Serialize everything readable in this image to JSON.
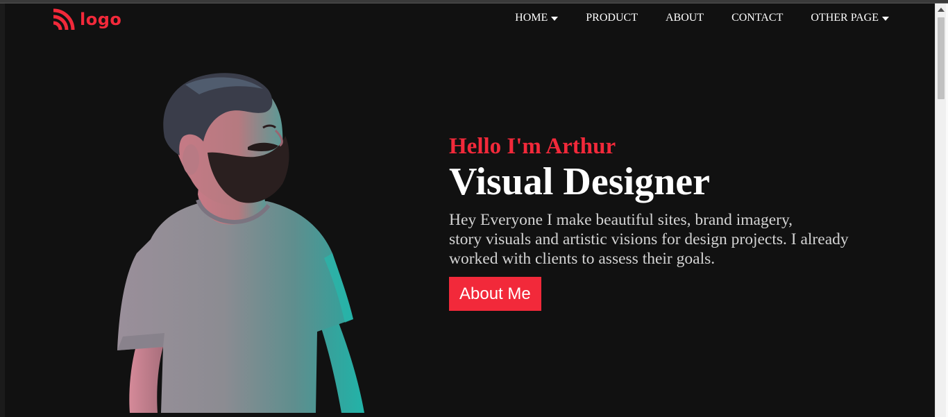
{
  "brand": {
    "logo_text": "logo",
    "accent_color": "#f2293a",
    "logo_icon": "rss-icon"
  },
  "nav": {
    "items": [
      {
        "label": "HOME",
        "has_dropdown": true
      },
      {
        "label": "PRODUCT",
        "has_dropdown": false
      },
      {
        "label": "ABOUT",
        "has_dropdown": false
      },
      {
        "label": "CONTACT",
        "has_dropdown": false
      },
      {
        "label": "OTHER PAGE",
        "has_dropdown": true
      }
    ]
  },
  "hero": {
    "greeting": "Hello I'm Arthur",
    "headline": "Visual Designer",
    "intro_lines": [
      "Hey Everyone I make beautiful sites, brand imagery,",
      "story visuals and artistic visions for design projects. I already",
      "worked with clients to assess their goals."
    ],
    "cta_label": "About Me",
    "portrait": "man-with-beard-portrait"
  },
  "colors": {
    "background": "#111111",
    "text": "#ffffff",
    "muted_text": "#d4d4d4"
  }
}
